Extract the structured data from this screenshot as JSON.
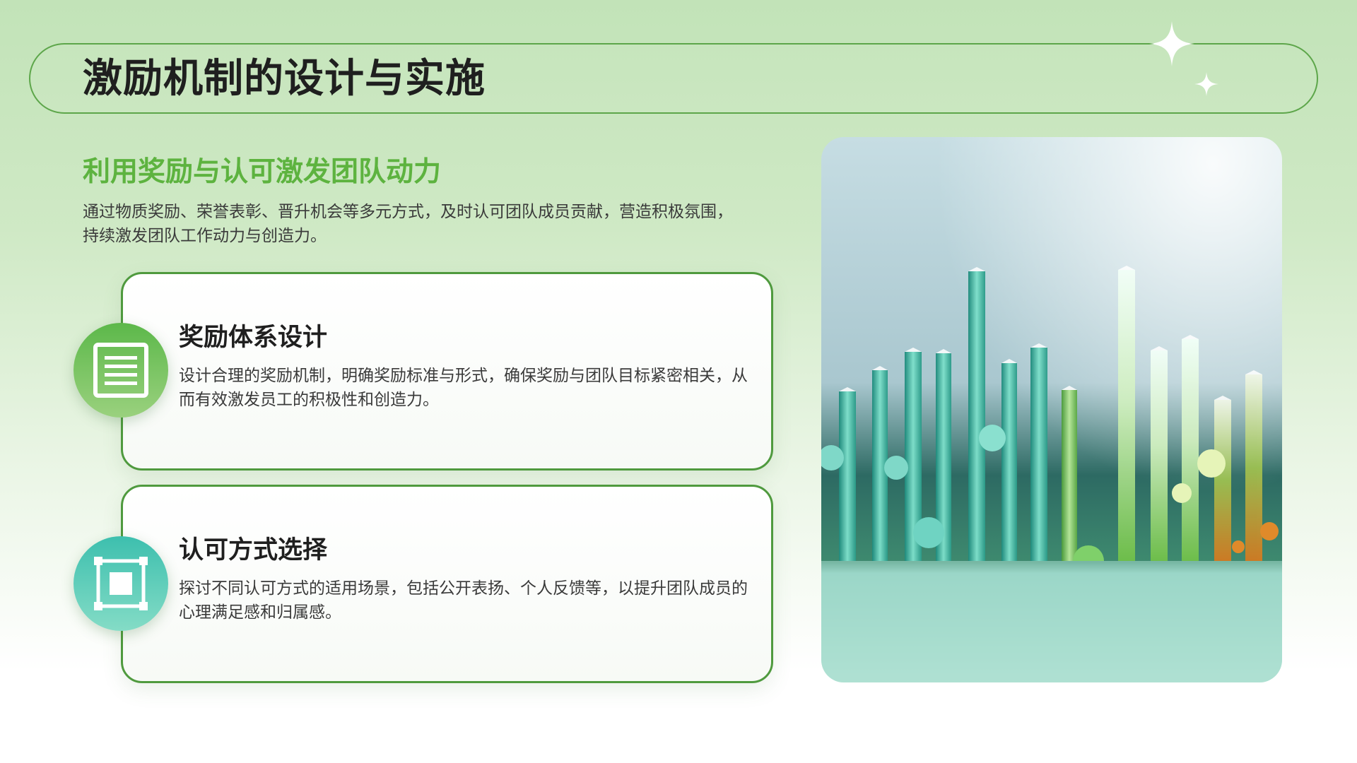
{
  "slide": {
    "title": "激励机制的设计与实施",
    "subtitle": "利用奖励与认可激发团队动力",
    "intro": "通过物质奖励、荣誉表彰、晋升机会等多元方式，及时认可团队成员贡献，营造积极氛围，持续激发团队工作动力与创造力。"
  },
  "cards": [
    {
      "title": "奖励体系设计",
      "text": "设计合理的奖励机制，明确奖励标准与形式，确保奖励与团队目标紧密相关，从而有效激发员工的积极性和创造力。",
      "icon": "document-list-icon"
    },
    {
      "title": "认可方式选择",
      "text": "探讨不同认可方式的适用场景，包括公开表扬、个人反馈等，以提升团队成员的心理满足感和归属感。",
      "icon": "frame-select-icon"
    }
  ],
  "colors": {
    "accent_green": "#5db33f",
    "border_green": "#4f9a3e",
    "teal": "#3dbfae"
  }
}
